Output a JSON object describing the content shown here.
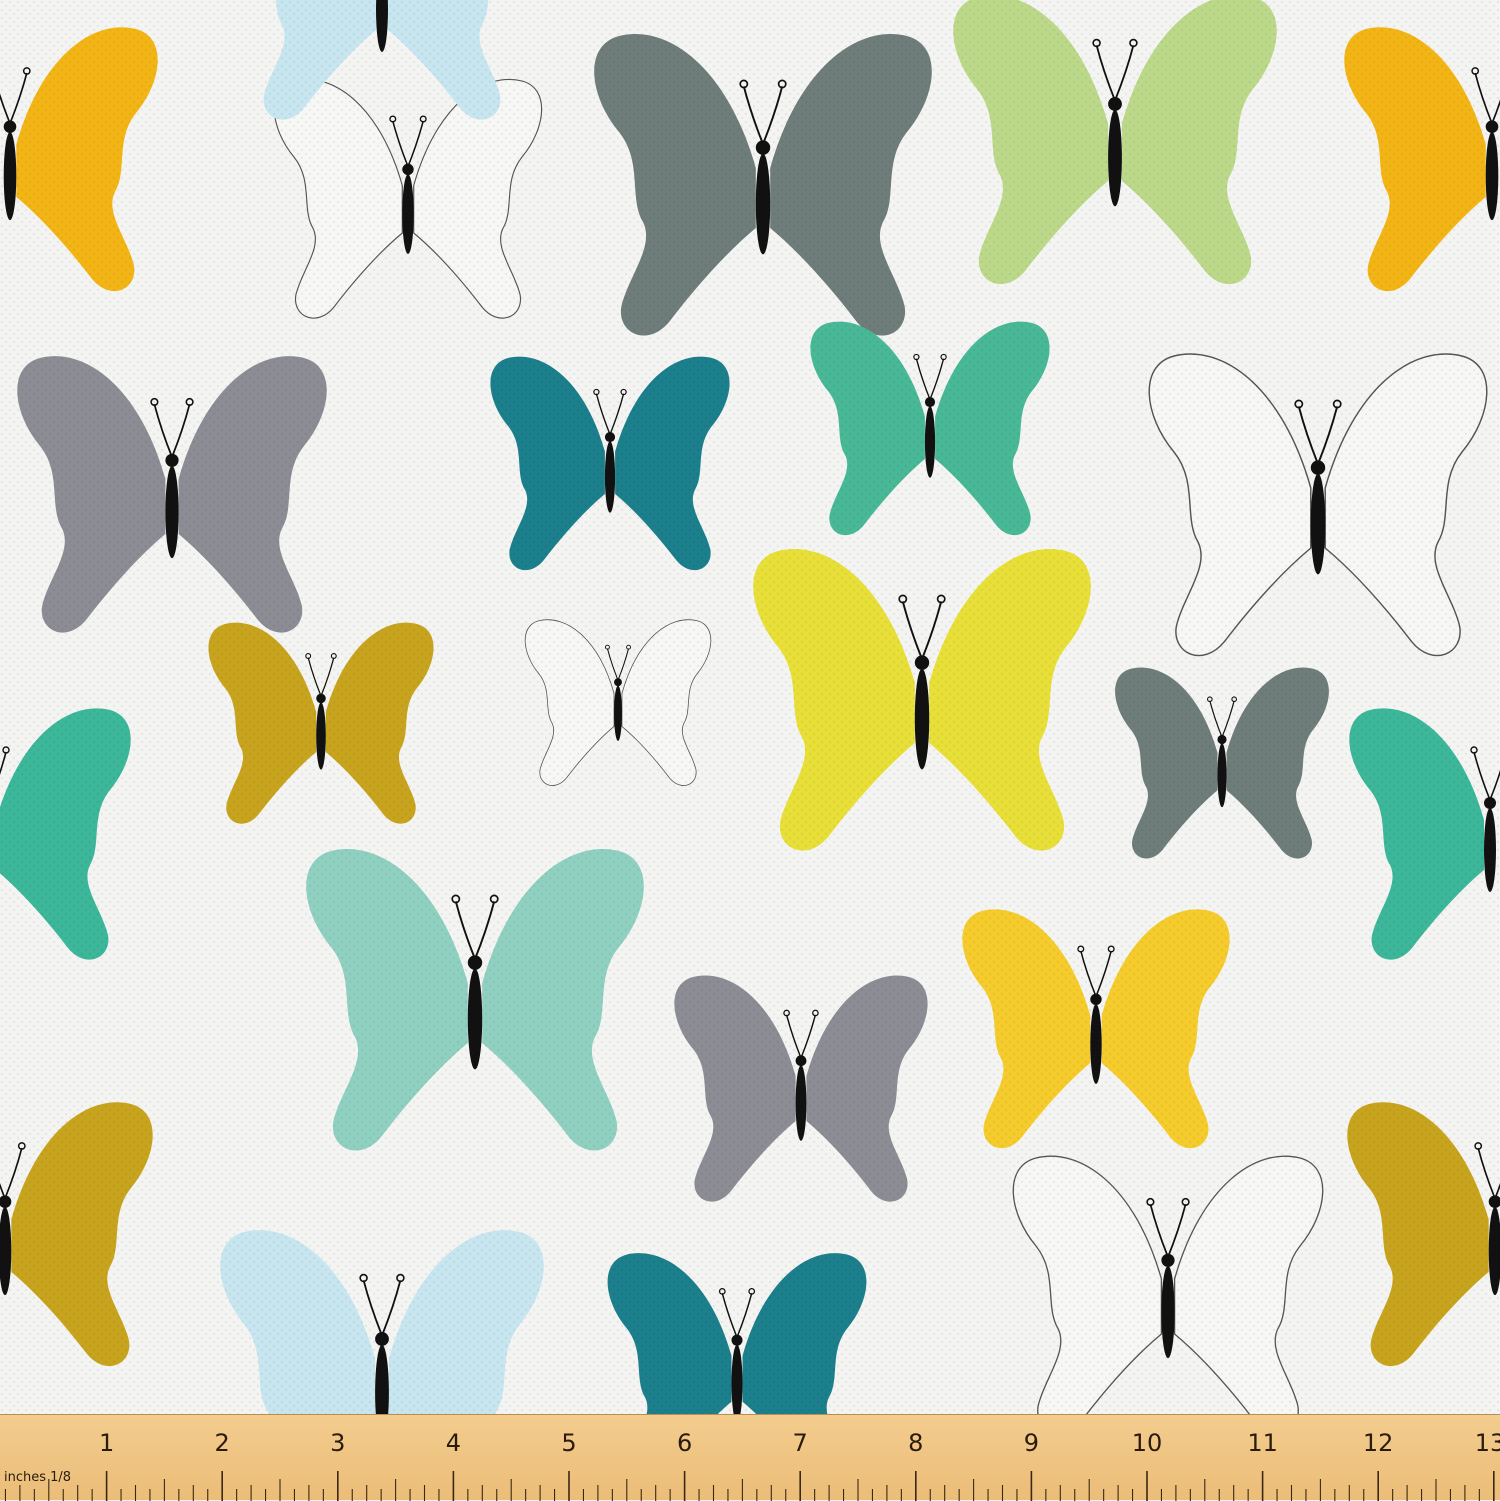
{
  "image": {
    "subject": "Butterfly print fabric",
    "background_color": "#f4f4f2",
    "wing_outline_color": "#222222",
    "body_color": "#111111"
  },
  "butterflies": [
    {
      "id": "bf-1",
      "color": "#f3b515"
    },
    {
      "id": "bf-2",
      "color": "#f7f7f5"
    },
    {
      "id": "bf-3",
      "color": "#6f7d7a"
    },
    {
      "id": "bf-4",
      "color": "#bcd98a"
    },
    {
      "id": "bf-5",
      "color": "#f3b515"
    },
    {
      "id": "bf-6",
      "color": "#8c8c94"
    },
    {
      "id": "bf-7",
      "color": "#1c7f8c"
    },
    {
      "id": "bf-8",
      "color": "#48b897"
    },
    {
      "id": "bf-9",
      "color": "#f7f7f5"
    },
    {
      "id": "bf-10",
      "color": "#c8a41e"
    },
    {
      "id": "bf-11",
      "color": "#f7f7f5"
    },
    {
      "id": "bf-12",
      "color": "#e8e038"
    },
    {
      "id": "bf-13",
      "color": "#6f7d7a"
    },
    {
      "id": "bf-14",
      "color": "#3cb79a"
    },
    {
      "id": "bf-15",
      "color": "#3cb79a"
    },
    {
      "id": "bf-16",
      "color": "#8fd0c0"
    },
    {
      "id": "bf-17",
      "color": "#8c8c94"
    },
    {
      "id": "bf-18",
      "color": "#f5cc2c"
    },
    {
      "id": "bf-19",
      "color": "#c8a41e"
    },
    {
      "id": "bf-20",
      "color": "#c8a41e"
    },
    {
      "id": "bf-21",
      "color": "#c8e6f0"
    },
    {
      "id": "bf-22",
      "color": "#1c7f8c"
    },
    {
      "id": "bf-23",
      "color": "#f7f7f5"
    },
    {
      "id": "bf-24",
      "color": "#c8e6f0"
    }
  ],
  "ruler": {
    "unit_label": "inches 1/8",
    "numbers": [
      "1",
      "2",
      "3",
      "4",
      "5",
      "6",
      "7",
      "8",
      "9",
      "10",
      "11",
      "12",
      "13"
    ]
  }
}
